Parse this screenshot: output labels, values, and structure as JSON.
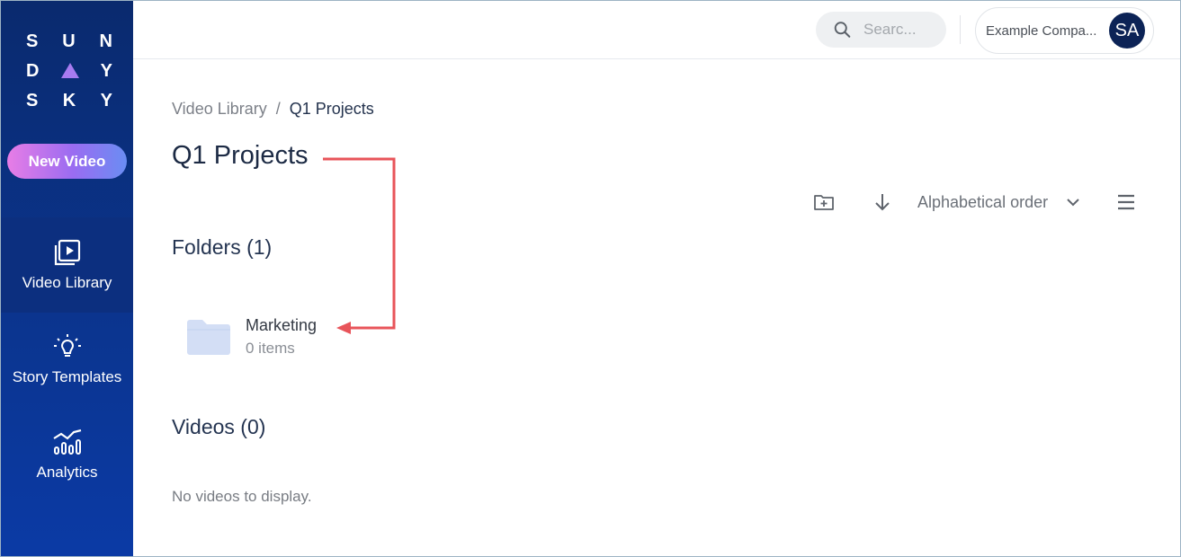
{
  "sidebar": {
    "logo": {
      "row1": [
        "S",
        "U",
        "N"
      ],
      "row2": [
        "D",
        "Y"
      ],
      "row3": [
        "S",
        "K",
        "Y"
      ]
    },
    "new_video_label": "New Video",
    "items": [
      {
        "label": "Video Library",
        "icon": "play-square-icon",
        "active": true
      },
      {
        "label": "Story Templates",
        "icon": "lightbulb-icon",
        "active": false
      },
      {
        "label": "Analytics",
        "icon": "analytics-chart-icon",
        "active": false
      }
    ]
  },
  "topbar": {
    "search_placeholder": "Searc...",
    "account_name": "Example Compa...",
    "avatar_initials": "SA"
  },
  "main": {
    "breadcrumb": {
      "parent": "Video Library",
      "separator": "/",
      "current": "Q1 Projects"
    },
    "title": "Q1 Projects",
    "toolbar": {
      "sort_label": "Alphabetical order",
      "icons": [
        "new-folder-icon",
        "sort-direction-icon",
        "chevron-down-icon",
        "list-menu-icon"
      ]
    },
    "folders_title": "Folders (1)",
    "folders": [
      {
        "name": "Marketing",
        "count": "0 items"
      }
    ],
    "videos_title": "Videos (0)",
    "videos_empty": "No videos to display."
  },
  "colors": {
    "sidebar": "#0b3590",
    "accent_pink": "#e87de6",
    "accent_violet": "#9a6cf1",
    "annotation_arrow": "#e8545a",
    "folder_icon": "#d3def5"
  }
}
